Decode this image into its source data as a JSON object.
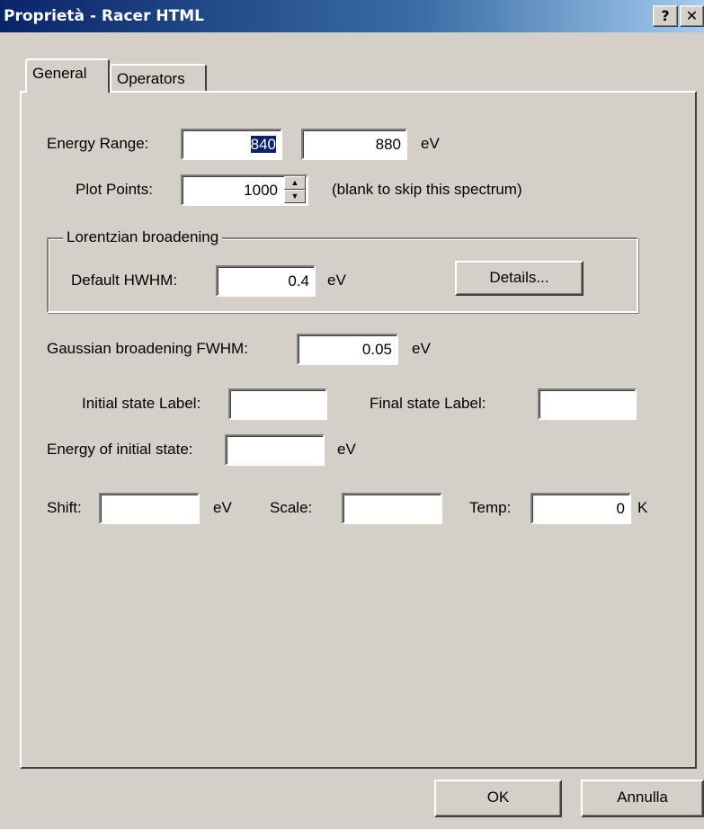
{
  "window": {
    "title": "Proprietà - Racer HTML",
    "help_glyph": "?",
    "close_glyph": "✕"
  },
  "tabs": [
    {
      "label": "General"
    },
    {
      "label": "Operators"
    }
  ],
  "energy_range": {
    "label": "Energy Range:",
    "min": "840",
    "max": "880",
    "unit": "eV"
  },
  "plot_points": {
    "label": "Plot Points:",
    "value": "1000",
    "hint": "(blank to skip this spectrum)"
  },
  "lorentzian": {
    "legend": "Lorentzian broadening",
    "label": "Default HWHM:",
    "value": "0.4",
    "unit": "eV",
    "details_label": "Details..."
  },
  "gaussian": {
    "label": "Gaussian broadening FWHM:",
    "value": "0.05",
    "unit": "eV"
  },
  "initial_state": {
    "label": "Initial state Label:",
    "value": ""
  },
  "final_state": {
    "label": "Final state Label:",
    "value": ""
  },
  "energy_initial": {
    "label": "Energy of initial state:",
    "value": "",
    "unit": "eV"
  },
  "shift": {
    "label": "Shift:",
    "value": "",
    "unit": "eV"
  },
  "scale": {
    "label": "Scale:",
    "value": ""
  },
  "temp": {
    "label": "Temp:",
    "value": "0",
    "unit": "K"
  },
  "footer": {
    "ok_label": "OK",
    "cancel_label": "Annulla"
  },
  "colors": {
    "face": "#d4d0c8",
    "title_start": "#0a246a",
    "title_end": "#a6caf0",
    "selection": "#0a246a"
  }
}
